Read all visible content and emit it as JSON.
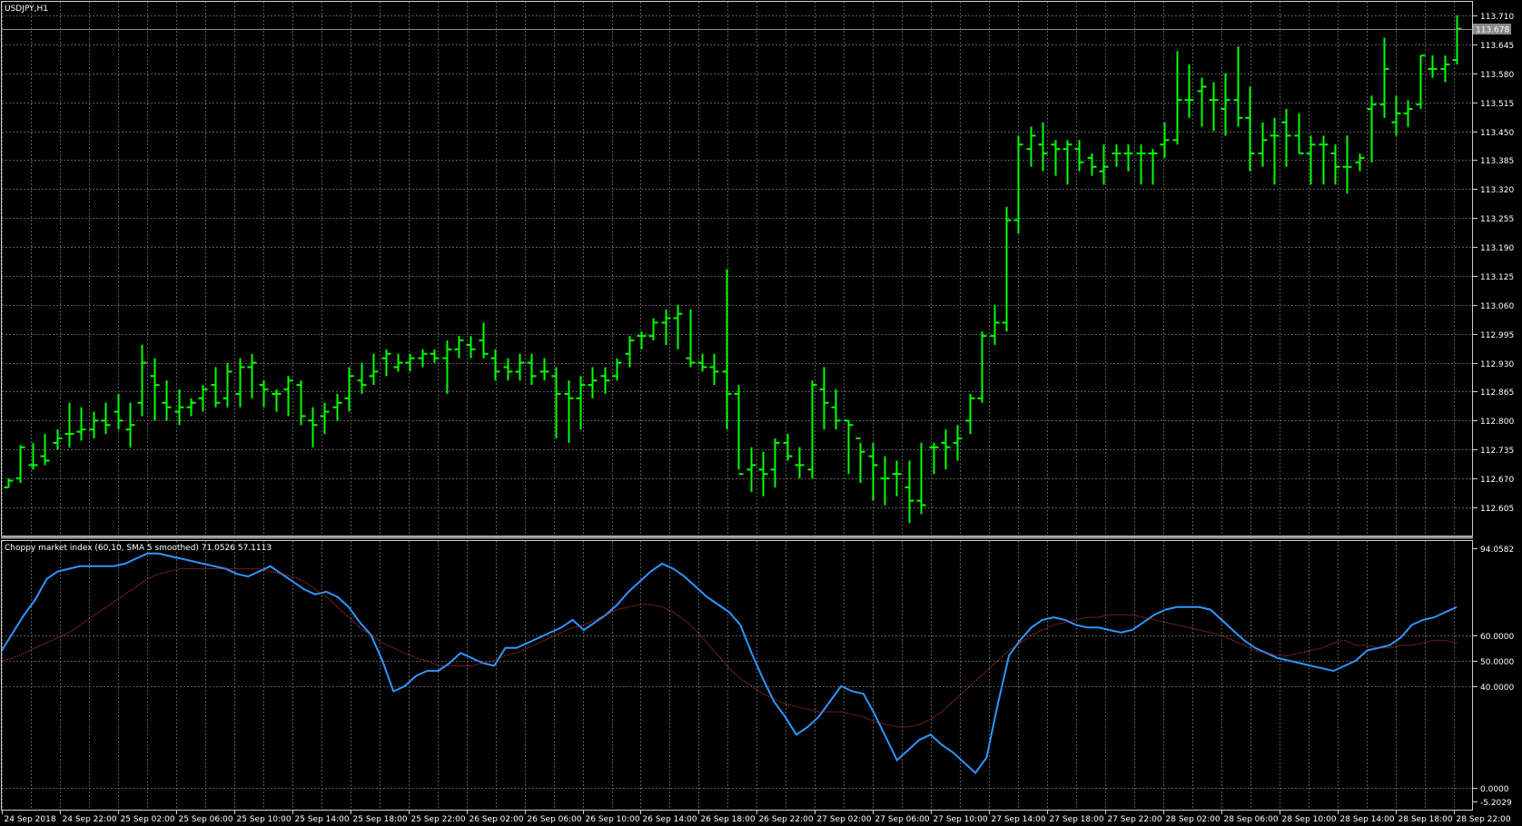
{
  "chart_data": [
    {
      "type": "ohlc",
      "title": "USDJPY,H1",
      "current_price": "113.678",
      "colors": {
        "bars": "#00ff00",
        "grid": "#4a4a4a",
        "background": "#000000",
        "text": "#ffffff"
      },
      "ylim": [
        112.56,
        113.73
      ],
      "y_ticks": [
        "113.710",
        "113.645",
        "113.580",
        "113.515",
        "113.450",
        "113.385",
        "113.320",
        "113.255",
        "113.190",
        "113.125",
        "113.060",
        "112.995",
        "112.930",
        "112.865",
        "112.800",
        "112.735",
        "112.670",
        "112.605"
      ],
      "ohlc": [
        [
          112.65,
          112.67,
          112.65,
          112.665
        ],
        [
          112.67,
          112.745,
          112.66,
          112.74
        ],
        [
          112.7,
          112.75,
          112.69,
          112.7
        ],
        [
          112.72,
          112.77,
          112.7,
          112.71
        ],
        [
          112.75,
          112.78,
          112.735,
          112.76
        ],
        [
          112.77,
          112.84,
          112.74,
          112.77
        ],
        [
          112.775,
          112.83,
          112.755,
          112.78
        ],
        [
          112.78,
          112.82,
          112.76,
          112.8
        ],
        [
          112.8,
          112.84,
          112.77,
          112.79
        ],
        [
          112.82,
          112.86,
          112.78,
          112.8
        ],
        [
          112.78,
          112.84,
          112.74,
          112.79
        ],
        [
          112.84,
          112.97,
          112.81,
          112.93
        ],
        [
          112.9,
          112.94,
          112.8,
          112.88
        ],
        [
          112.84,
          112.89,
          112.8,
          112.83
        ],
        [
          112.82,
          112.87,
          112.79,
          112.83
        ],
        [
          112.83,
          112.85,
          112.81,
          112.84
        ],
        [
          112.85,
          112.88,
          112.82,
          112.87
        ],
        [
          112.88,
          112.92,
          112.83,
          112.84
        ],
        [
          112.85,
          112.93,
          112.83,
          112.91
        ],
        [
          112.86,
          112.94,
          112.83,
          112.92
        ],
        [
          112.92,
          112.95,
          112.85,
          112.93
        ],
        [
          112.88,
          112.89,
          112.83,
          112.87
        ],
        [
          112.86,
          112.87,
          112.82,
          112.86
        ],
        [
          112.87,
          112.9,
          112.81,
          112.89
        ],
        [
          112.88,
          112.89,
          112.79,
          112.81
        ],
        [
          112.8,
          112.83,
          112.74,
          112.79
        ],
        [
          112.81,
          112.84,
          112.77,
          112.82
        ],
        [
          112.83,
          112.86,
          112.8,
          112.84
        ],
        [
          112.85,
          112.92,
          112.82,
          112.9
        ],
        [
          112.89,
          112.93,
          112.86,
          112.88
        ],
        [
          112.9,
          112.95,
          112.88,
          112.91
        ],
        [
          112.94,
          112.96,
          112.9,
          112.95
        ],
        [
          112.92,
          112.95,
          112.91,
          112.93
        ],
        [
          112.93,
          112.95,
          112.91,
          112.94
        ],
        [
          112.94,
          112.96,
          112.92,
          112.95
        ],
        [
          112.95,
          112.96,
          112.93,
          112.94
        ],
        [
          112.94,
          112.98,
          112.86,
          112.96
        ],
        [
          112.96,
          112.99,
          112.94,
          112.98
        ],
        [
          112.97,
          112.99,
          112.94,
          112.96
        ],
        [
          112.98,
          113.02,
          112.94,
          112.95
        ],
        [
          112.94,
          112.96,
          112.89,
          112.91
        ],
        [
          112.92,
          112.94,
          112.89,
          112.91
        ],
        [
          112.91,
          112.95,
          112.89,
          112.93
        ],
        [
          112.93,
          112.95,
          112.88,
          112.9
        ],
        [
          112.91,
          112.94,
          112.89,
          112.91
        ],
        [
          112.9,
          112.92,
          112.76,
          112.86
        ],
        [
          112.86,
          112.89,
          112.75,
          112.85
        ],
        [
          112.85,
          112.9,
          112.78,
          112.88
        ],
        [
          112.88,
          112.92,
          112.85,
          112.89
        ],
        [
          112.9,
          112.92,
          112.86,
          112.89
        ],
        [
          112.9,
          112.94,
          112.89,
          112.93
        ],
        [
          112.95,
          112.99,
          112.92,
          112.98
        ],
        [
          112.99,
          113.0,
          112.96,
          112.99
        ],
        [
          112.99,
          113.03,
          112.98,
          113.02
        ],
        [
          113.02,
          113.05,
          112.97,
          113.03
        ],
        [
          113.03,
          113.06,
          112.96,
          113.04
        ],
        [
          112.94,
          113.05,
          112.92,
          112.93
        ],
        [
          112.93,
          112.95,
          112.91,
          112.92
        ],
        [
          112.92,
          112.95,
          112.88,
          112.91
        ],
        [
          112.91,
          113.14,
          112.78,
          112.86
        ],
        [
          112.86,
          112.88,
          112.69,
          112.68
        ],
        [
          112.69,
          112.74,
          112.64,
          112.7
        ],
        [
          112.69,
          112.73,
          112.63,
          112.68
        ],
        [
          112.69,
          112.76,
          112.65,
          112.75
        ],
        [
          112.75,
          112.77,
          112.71,
          112.72
        ],
        [
          112.7,
          112.74,
          112.67,
          112.7
        ],
        [
          112.69,
          112.89,
          112.67,
          112.88
        ],
        [
          112.87,
          112.92,
          112.78,
          112.84
        ],
        [
          112.83,
          112.87,
          112.78,
          112.8
        ],
        [
          112.8,
          112.8,
          112.68,
          112.79
        ],
        [
          112.76,
          112.75,
          112.66,
          112.73
        ],
        [
          112.72,
          112.75,
          112.62,
          112.7
        ],
        [
          112.67,
          112.72,
          112.61,
          112.67
        ],
        [
          112.68,
          112.71,
          112.63,
          112.68
        ],
        [
          112.65,
          112.71,
          112.57,
          112.62
        ],
        [
          112.62,
          112.75,
          112.59,
          112.61
        ],
        [
          112.74,
          112.75,
          112.68,
          112.74
        ],
        [
          112.75,
          112.78,
          112.69,
          112.74
        ],
        [
          112.75,
          112.79,
          112.71,
          112.76
        ],
        [
          112.8,
          112.86,
          112.77,
          112.85
        ],
        [
          112.85,
          113.0,
          112.84,
          112.99
        ],
        [
          112.99,
          113.06,
          112.97,
          113.02
        ],
        [
          113.02,
          113.28,
          113.0,
          113.25
        ],
        [
          113.25,
          113.44,
          113.22,
          113.42
        ],
        [
          113.41,
          113.46,
          113.37,
          113.44
        ],
        [
          113.42,
          113.47,
          113.36,
          113.4
        ],
        [
          113.42,
          113.43,
          113.35,
          113.41
        ],
        [
          113.41,
          113.43,
          113.33,
          113.42
        ],
        [
          113.41,
          113.43,
          113.36,
          113.38
        ],
        [
          113.39,
          113.4,
          113.35,
          113.37
        ],
        [
          113.36,
          113.42,
          113.33,
          113.37
        ],
        [
          113.4,
          113.42,
          113.37,
          113.4
        ],
        [
          113.4,
          113.42,
          113.36,
          113.4
        ],
        [
          113.4,
          113.42,
          113.33,
          113.4
        ],
        [
          113.4,
          113.41,
          113.33,
          113.4
        ],
        [
          113.42,
          113.47,
          113.39,
          113.43
        ],
        [
          113.43,
          113.63,
          113.42,
          113.52
        ],
        [
          113.52,
          113.6,
          113.48,
          113.52
        ],
        [
          113.54,
          113.57,
          113.46,
          113.55
        ],
        [
          113.52,
          113.56,
          113.45,
          113.52
        ],
        [
          113.5,
          113.58,
          113.44,
          113.52
        ],
        [
          113.52,
          113.64,
          113.46,
          113.48
        ],
        [
          113.48,
          113.55,
          113.36,
          113.4
        ],
        [
          113.4,
          113.47,
          113.37,
          113.43
        ],
        [
          113.44,
          113.48,
          113.33,
          113.44
        ],
        [
          113.47,
          113.5,
          113.37,
          113.44
        ],
        [
          113.44,
          113.49,
          113.4,
          113.4
        ],
        [
          113.4,
          113.44,
          113.33,
          113.42
        ],
        [
          113.42,
          113.44,
          113.33,
          113.42
        ],
        [
          113.4,
          113.42,
          113.33,
          113.37
        ],
        [
          113.37,
          113.44,
          113.31,
          113.37
        ],
        [
          113.38,
          113.4,
          113.36,
          113.39
        ],
        [
          113.5,
          113.53,
          113.38,
          113.51
        ],
        [
          113.51,
          113.66,
          113.48,
          113.59
        ],
        [
          113.47,
          113.53,
          113.44,
          113.49
        ],
        [
          113.49,
          113.52,
          113.46,
          113.5
        ],
        [
          113.51,
          113.62,
          113.5,
          113.62
        ],
        [
          113.59,
          113.62,
          113.57,
          113.59
        ],
        [
          113.59,
          113.62,
          113.56,
          113.6
        ],
        [
          113.61,
          113.71,
          113.6,
          113.68
        ]
      ]
    },
    {
      "type": "line",
      "title": "Choppy market index (60,10, SMA 5 smoothed) 71.0526 57.1113",
      "ylim": [
        -5.2029,
        94.0582
      ],
      "y_ticks": [
        "94.0582",
        "60.0000",
        "50.0000",
        "40.0000",
        "0.0000",
        "-5.2029"
      ],
      "y_tick_values": [
        94.0582,
        60,
        50,
        40,
        0,
        -5.2029
      ],
      "series": [
        {
          "color": "#2f96ff",
          "style": "solid",
          "values": [
            54,
            61,
            68,
            74,
            82,
            85,
            86,
            87,
            87,
            87,
            87,
            88,
            90,
            92,
            92,
            91,
            90,
            89,
            88,
            87,
            86,
            84,
            83,
            85,
            87,
            84,
            81,
            78,
            76,
            77,
            75,
            71,
            65,
            60,
            50,
            38,
            40,
            44,
            46,
            46,
            49,
            53,
            51,
            49,
            48,
            55,
            55,
            57,
            59,
            61,
            63,
            66,
            62,
            65,
            68,
            72,
            77,
            81,
            85,
            88,
            86,
            83,
            79,
            75,
            72,
            69,
            64,
            53,
            43,
            34,
            28,
            21,
            24,
            28,
            34,
            40,
            38,
            37,
            29,
            20,
            11,
            15,
            19,
            21,
            17,
            14,
            10,
            6,
            12,
            33,
            52,
            58,
            63,
            66,
            67,
            66,
            64,
            63,
            63,
            62,
            61,
            62,
            65,
            68,
            70,
            71,
            71,
            71,
            70,
            66,
            62,
            58,
            55,
            53,
            51,
            50,
            49,
            48,
            47,
            46,
            48,
            50,
            54,
            55,
            56,
            59,
            64,
            66,
            67,
            69,
            71
          ]
        },
        {
          "color": "#d23c3c",
          "style": "dotted",
          "values": [
            50,
            51,
            53,
            55,
            57,
            59,
            61,
            64,
            67,
            70,
            73,
            76,
            79,
            82,
            84,
            85,
            86,
            86,
            86,
            86,
            86,
            86,
            86,
            86,
            85,
            84,
            83,
            81,
            78,
            75,
            71,
            67,
            63,
            60,
            57,
            55,
            53,
            51,
            50,
            48,
            48,
            48,
            48,
            49,
            50,
            52,
            53,
            55,
            57,
            59,
            61,
            63,
            64,
            66,
            68,
            70,
            71,
            72,
            72,
            71,
            69,
            66,
            62,
            57,
            52,
            47,
            43,
            40,
            37,
            35,
            33,
            32,
            31,
            30,
            30,
            30,
            29,
            28,
            26,
            25,
            24,
            24,
            25,
            27,
            30,
            34,
            38,
            42,
            46,
            50,
            54,
            57,
            60,
            62,
            64,
            65,
            66,
            67,
            67,
            68,
            68,
            68,
            67,
            66,
            65,
            64,
            63,
            62,
            61,
            60,
            58,
            56,
            54,
            53,
            52,
            52,
            53,
            54,
            55,
            57,
            58,
            56,
            56,
            55,
            55,
            56,
            56,
            57,
            58,
            58,
            57
          ]
        }
      ]
    }
  ],
  "x_labels": [
    "24 Sep 2018",
    "24 Sep 22:00",
    "25 Sep 02:00",
    "25 Sep 06:00",
    "25 Sep 10:00",
    "25 Sep 14:00",
    "25 Sep 18:00",
    "25 Sep 22:00",
    "26 Sep 02:00",
    "26 Sep 06:00",
    "26 Sep 10:00",
    "26 Sep 14:00",
    "26 Sep 18:00",
    "26 Sep 22:00",
    "27 Sep 02:00",
    "27 Sep 06:00",
    "27 Sep 10:00",
    "27 Sep 14:00",
    "27 Sep 18:00",
    "27 Sep 22:00",
    "28 Sep 02:00",
    "28 Sep 06:00",
    "28 Sep 10:00",
    "28 Sep 14:00",
    "28 Sep 18:00",
    "28 Sep 22:00"
  ]
}
